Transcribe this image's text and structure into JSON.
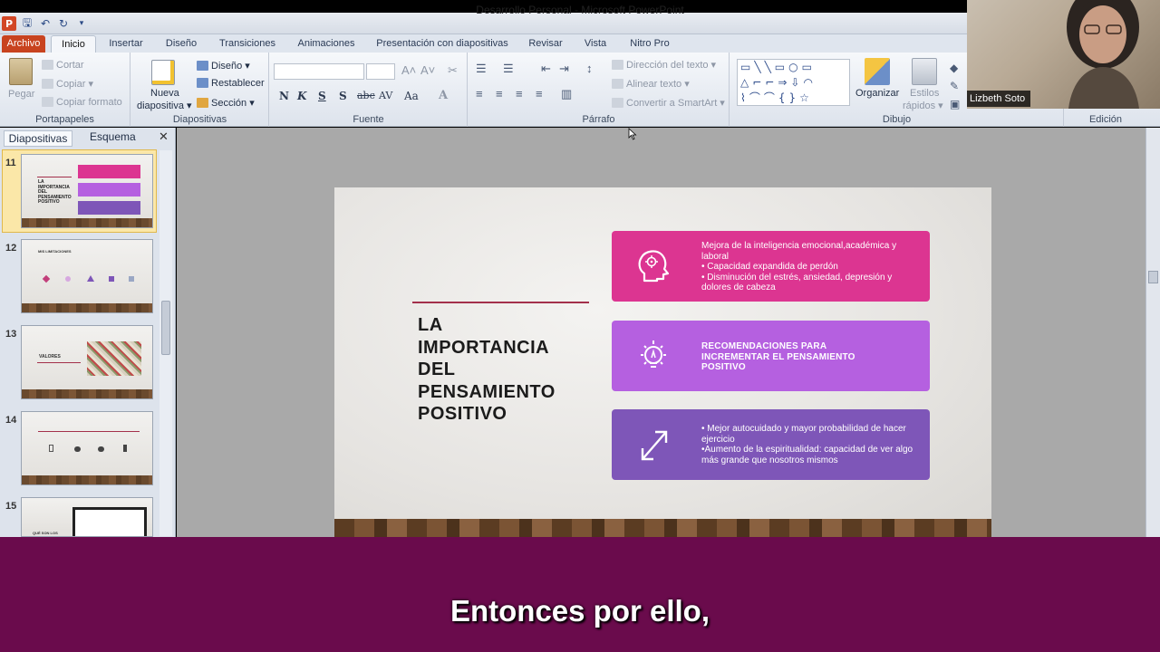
{
  "window": {
    "title": "Desarrollo Personal  -  Microsoft PowerPoint"
  },
  "qat": {
    "app_icon": "P"
  },
  "tabs": [
    "Archivo",
    "Inicio",
    "Insertar",
    "Diseño",
    "Transiciones",
    "Animaciones",
    "Presentación con diapositivas",
    "Revisar",
    "Vista",
    "Nitro Pro"
  ],
  "ribbon": {
    "clipboard": {
      "paste": "Pegar",
      "cut": "Cortar",
      "copy": "Copiar",
      "format": "Copiar formato",
      "label": "Portapapeles"
    },
    "slides": {
      "new": "Nueva",
      "new2": "diapositiva",
      "layout": "Diseño",
      "reset": "Restablecer",
      "section": "Sección",
      "label": "Diapositivas"
    },
    "font": {
      "label": "Fuente",
      "bold": "N",
      "italic": "K",
      "underline": "S",
      "shadow": "S",
      "strike": "abc",
      "spacing": "AV",
      "case": "Aa",
      "color": "A"
    },
    "paragraph": {
      "direction": "Dirección del texto",
      "align": "Alinear texto",
      "smartart": "Convertir a SmartArt",
      "label": "Párrafo"
    },
    "drawing": {
      "arrange": "Organizar",
      "styles": "Estilos",
      "styles2": "rápidos",
      "label": "Dibujo"
    },
    "edit": {
      "label": "Edición"
    }
  },
  "pane": {
    "tab_slides": "Diapositivas",
    "tab_outline": "Esquema"
  },
  "thumbnails": [
    {
      "num": "11"
    },
    {
      "num": "12",
      "title": "MIS LIMITACIONES"
    },
    {
      "num": "13",
      "title": "VALORES"
    },
    {
      "num": "14"
    },
    {
      "num": "15",
      "title": "QUÉ SON LOS"
    }
  ],
  "slide": {
    "title_lines": [
      "LA",
      "IMPORTANCIA",
      "DEL",
      "PENSAMIENTO",
      "POSITIVO"
    ],
    "card1": [
      "Mejora de la inteligencia emocional,académica y",
      "laboral",
      "• Capacidad expandida de perdón",
      "• Disminución del estrés, ansiedad, depresión y",
      "dolores de cabeza"
    ],
    "card2": [
      "RECOMENDACIONES PARA",
      "INCREMENTAR EL PENSAMIENTO",
      "POSITIVO"
    ],
    "card3": [
      "• Mejor autocuidado y mayor probabilidad de hacer",
      "ejercicio",
      "•Aumento de la espiritualidad: capacidad de ver algo",
      "más grande que nosotros mismos"
    ]
  },
  "webcam": {
    "name": "Lizbeth Soto"
  },
  "subtitle": "Entonces por ello,"
}
